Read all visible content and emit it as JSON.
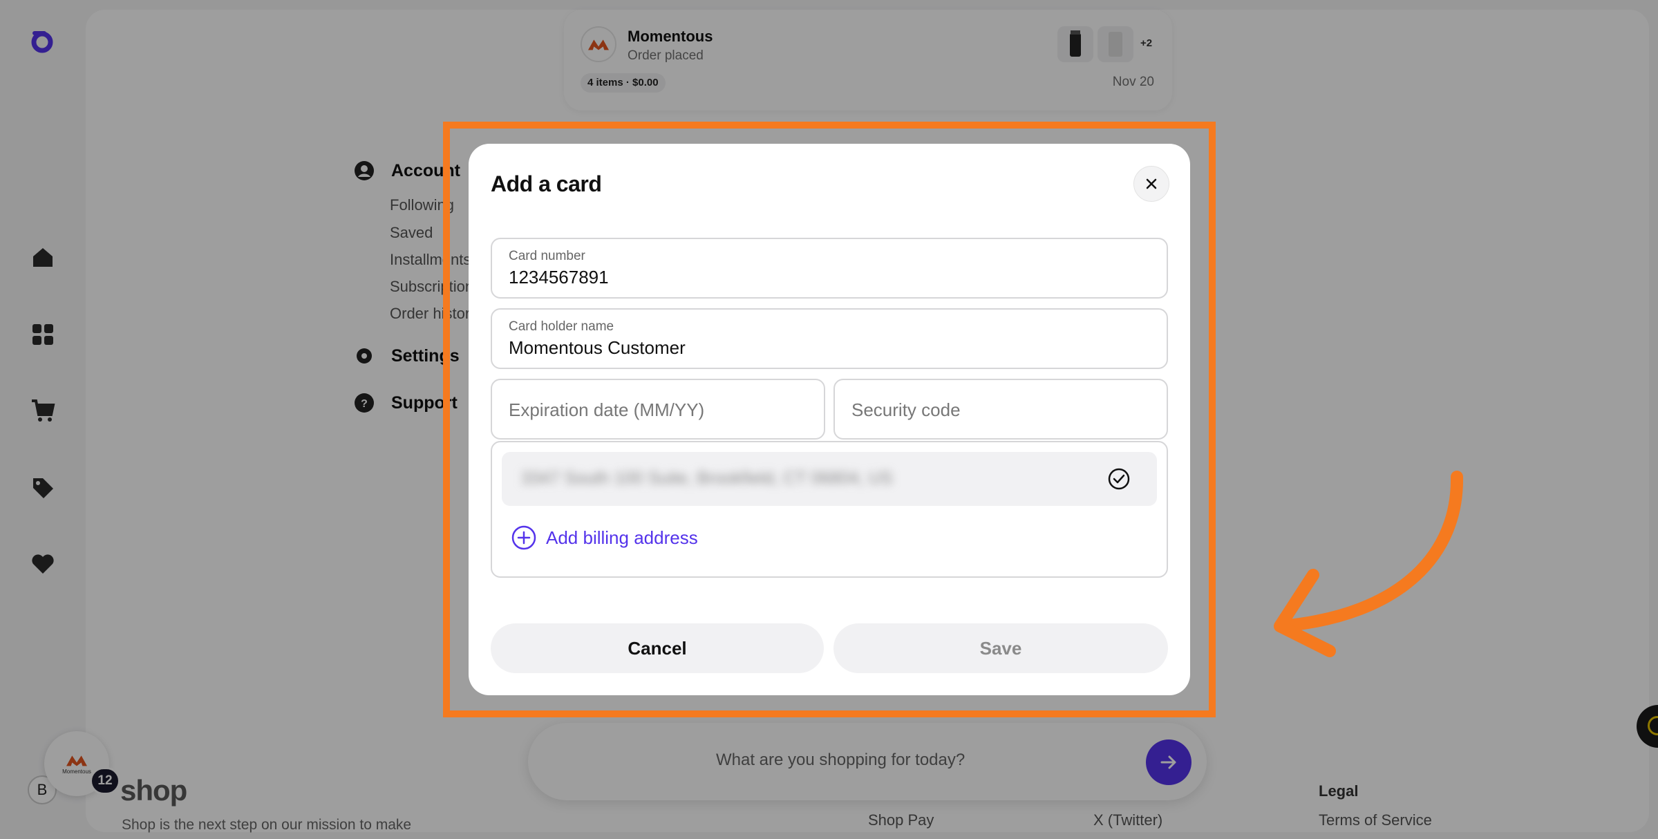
{
  "order": {
    "brand": "Momentous",
    "status": "Order placed",
    "items_summary": "4 items · $0.00",
    "more_count": "+2",
    "date": "Nov 20"
  },
  "account_menu": {
    "account": "Account",
    "following": "Following",
    "saved": "Saved",
    "installments": "Installments",
    "subscriptions": "Subscriptions",
    "order_history": "Order history",
    "settings": "Settings",
    "support": "Support"
  },
  "chat": {
    "placeholder": "What are you shopping for today?"
  },
  "footer": {
    "logo": "shop",
    "tagline": "Shop is the next step on our mission to make",
    "shop_pay": "Shop Pay",
    "x_twitter": "X (Twitter)",
    "legal_heading": "Legal",
    "terms": "Terms of Service"
  },
  "merchant_bubble": {
    "label": "Momentous",
    "badge_count": "12"
  },
  "user_avatar": "B",
  "modal": {
    "title": "Add a card",
    "card_number_label": "Card number",
    "card_number_value": "1234567891",
    "card_holder_label": "Card holder name",
    "card_holder_value": "Momentous Customer",
    "expiration_placeholder": "Expiration date (MM/YY)",
    "security_placeholder": "Security code",
    "billing_address_redacted": "3347 South 100 Suite, Brookfield, CT 06804, US",
    "add_billing": "Add billing address",
    "cancel": "Cancel",
    "save": "Save"
  },
  "colors": {
    "accent": "#5433eb",
    "annotation": "#f57a1f",
    "brand_logo": "#e2541f"
  }
}
